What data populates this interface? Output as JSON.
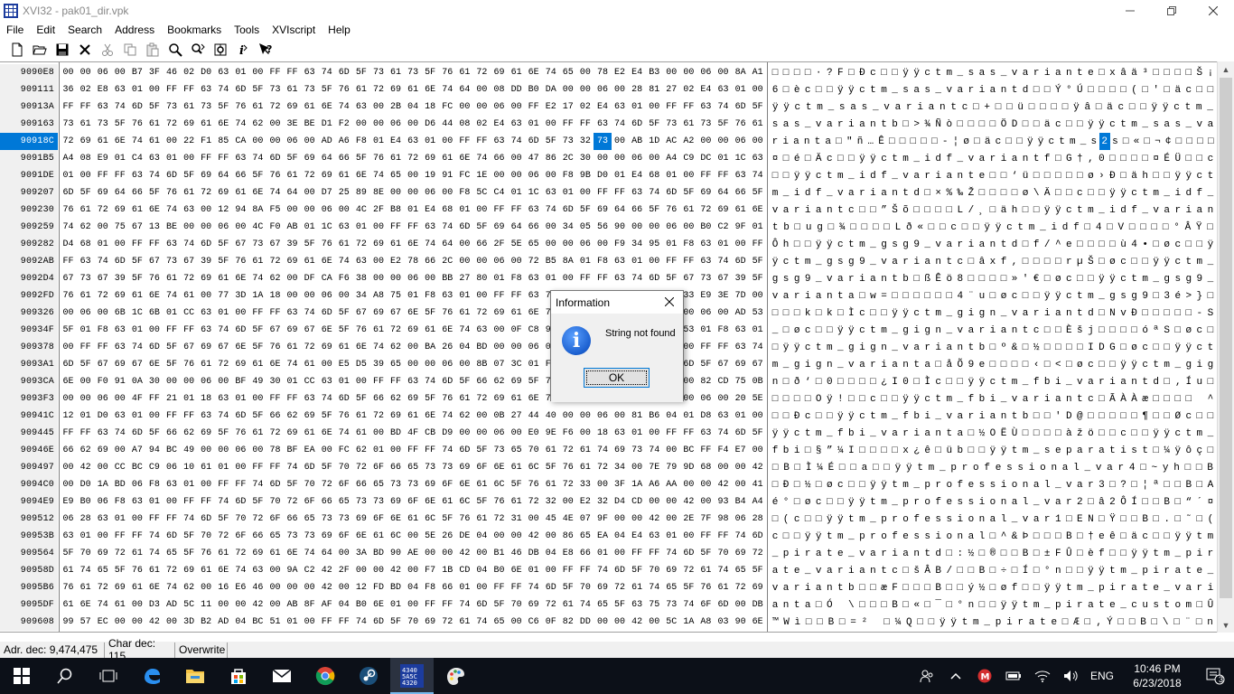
{
  "window": {
    "title": "XVI32 - pak01_dir.vpk",
    "controls": [
      "minimize",
      "maximize",
      "close"
    ]
  },
  "menu": [
    "File",
    "Edit",
    "Search",
    "Address",
    "Bookmarks",
    "Tools",
    "XVIscript",
    "Help"
  ],
  "toolbar": [
    {
      "icon": "new-file-icon"
    },
    {
      "icon": "open-folder-icon"
    },
    {
      "icon": "save-icon"
    },
    {
      "icon": "close-file-icon"
    },
    {
      "icon": "cut-icon"
    },
    {
      "icon": "copy-icon"
    },
    {
      "icon": "paste-icon"
    },
    {
      "icon": "find-icon"
    },
    {
      "icon": "replace-icon"
    },
    {
      "icon": "settings-icon"
    },
    {
      "icon": "script-icon"
    },
    {
      "icon": "help-icon"
    }
  ],
  "editor": {
    "selected_row": 4,
    "selected_col": 31,
    "addresses": [
      "9090E8",
      "909111",
      "90913A",
      "909163",
      "90918C",
      "9091B5",
      "9091DE",
      "909207",
      "909230",
      "909259",
      "909282",
      "9092AB",
      "9092D4",
      "9092FD",
      "909326",
      "90934F",
      "909378",
      "9093A1",
      "9093CA",
      "9093F3",
      "90941C",
      "909445",
      "90946E",
      "909497",
      "9094C0",
      "9094E9",
      "909512",
      "90953B",
      "909564",
      "90958D",
      "9095B6",
      "9095DF",
      "909608"
    ],
    "hex_rows": [
      "00 00 06 00 B7 3F 46 02 D0 63 01 00 FF FF 63 74 6D 5F 73 61 73 5F 76 61 72 69 61 6E 74 65 00 78 E2 E4 B3 00 00 06 00 8A A1",
      "36 02 E8 63 01 00 FF FF 63 74 6D 5F 73 61 73 5F 76 61 72 69 61 6E 74 64 00 08 DD B0 DA 00 00 06 00 28 81 27 02 E4 63 01 00",
      "FF FF 63 74 6D 5F 73 61 73 5F 76 61 72 69 61 6E 74 63 00 2B 04 18 FC 00 00 06 00 FF E2 17 02 E4 63 01 00 FF FF 63 74 6D 5F",
      "73 61 73 5F 76 61 72 69 61 6E 74 62 00 3E BE D1 F2 00 00 06 00 D6 44 08 02 E4 63 01 00 FF FF 63 74 6D 5F 73 61 73 5F 76 61",
      "72 69 61 6E 74 61 00 22 F1 85 CA 00 00 06 00 AD A6 F8 01 E4 63 01 00 FF FF 63 74 6D 5F 73 32 73 00 AB 1D AC A2 00 00 06 00",
      "A4 08 E9 01 C4 63 01 00 FF FF 63 74 6D 5F 69 64 66 5F 76 61 72 69 61 6E 74 66 00 47 86 2C 30 00 00 06 00 A4 C9 DC 01 1C 63",
      "01 00 FF FF 63 74 6D 5F 69 64 66 5F 76 61 72 69 61 6E 74 65 00 19 91 FC 1E 00 00 06 00 F8 9B D0 01 E4 68 01 00 FF FF 63 74",
      "6D 5F 69 64 66 5F 76 61 72 69 61 6E 74 64 00 D7 25 89 8E 00 00 06 00 F8 5C C4 01 1C 63 01 00 FF FF 63 74 6D 5F 69 64 66 5F",
      "76 61 72 69 61 6E 74 63 00 12 94 8A F5 00 00 06 00 4C 2F B8 01 E4 68 01 00 FF FF 63 74 6D 5F 69 64 66 5F 76 61 72 69 61 6E",
      "74 62 00 75 67 13 BE 00 00 06 00 4C F0 AB 01 1C 63 01 00 FF FF 63 74 6D 5F 69 64 66 00 34 05 56 90 00 00 06 00 B0 C2 9F 01",
      "D4 68 01 00 FF FF 63 74 6D 5F 67 73 67 39 5F 76 61 72 69 61 6E 74 64 00 66 2F 5E 65 00 00 06 00 F9 34 95 01 F8 63 01 00 FF",
      "FF 63 74 6D 5F 67 73 67 39 5F 76 61 72 69 61 6E 74 63 00 E2 78 66 2C 00 00 06 00 72 B5 8A 01 F8 63 01 00 FF FF 63 74 6D 5F",
      "67 73 67 39 5F 76 61 72 69 61 6E 74 62 00 DF CA F6 38 00 00 06 00 BB 27 80 01 F8 63 01 00 FF FF 63 74 6D 5F 67 73 67 39 5F",
      "76 61 72 69 61 6E 74 61 00 77 3D 1A 18 00 00 06 00 34 A8 75 01 F8 63 01 00 FF FF 63 74 6D 5F 67 73 67 39 00 33 E9 3E 7D 00",
      "00 06 00 6B 1C 6B 01 CC 63 01 00 FF FF 63 74 6D 5F 67 69 67 6E 5F 76 61 72 69 61 6E 74 64 00 4E 76 AD 05 00 00 06 00 AD 53",
      "5F 01 F8 63 01 00 FF FF 63 74 6D 5F 67 69 67 6E 5F 76 61 72 69 61 6E 74 63 00 0F C8 9A 6A 00 00 06 00 F3 AA 53 01 F8 63 01",
      "00 FF FF 63 74 6D 5F 67 69 67 6E 5F 76 61 72 69 61 6E 74 62 00 BA 26 04 BD 00 00 06 00 49 44 47 01 F8 63 01 00 FF FF 63 74",
      "6D 5F 67 69 67 6E 5F 76 61 72 69 61 6E 74 61 00 E5 D5 39 65 00 00 06 00 8B 07 3C 01 F8 63 01 00 FF FF 63 74 6D 5F 67 69 67",
      "6E 00 F0 91 0A 30 00 00 06 00 BF 49 30 01 CC 63 01 00 FF FF 63 74 6D 5F 66 62 69 5F 76 61 72 69 61 6E 74 64 00 82 CD 75 0B",
      "00 00 06 00 4F FF 21 01 18 63 01 00 FF FF 63 74 6D 5F 66 62 69 5F 76 61 72 69 61 6E 74 63 00 C3 C0 C0 E6 00 00 06 00 20 5E",
      "12 01 D0 63 01 00 FF FF 63 74 6D 5F 66 62 69 5F 76 61 72 69 61 6E 74 62 00 0B 27 44 40 00 00 06 00 81 B6 04 01 D8 63 01 00",
      "FF FF 63 74 6D 5F 66 62 69 5F 76 61 72 69 61 6E 74 61 00 BD 4F CB D9 00 00 06 00 E0 9E F6 00 18 63 01 00 FF FF 63 74 6D 5F",
      "66 62 69 00 A7 94 BC 49 00 00 06 00 78 BF EA 00 FC 62 01 00 FF FF 74 6D 5F 73 65 70 61 72 61 74 69 73 74 00 BC FF F4 E7 00",
      "00 42 00 CC BC C9 06 10 61 01 00 FF FF 74 6D 5F 70 72 6F 66 65 73 73 69 6F 6E 61 6C 5F 76 61 72 34 00 7E 79 9D 68 00 00 42",
      "00 D0 1A BD 06 F8 63 01 00 FF FF 74 6D 5F 70 72 6F 66 65 73 73 69 6F 6E 61 6C 5F 76 61 72 33 00 3F 1A A6 AA 00 00 42 00 41",
      "E9 B0 06 F8 63 01 00 FF FF 74 6D 5F 70 72 6F 66 65 73 73 69 6F 6E 61 6C 5F 76 61 72 32 00 E2 32 D4 CD 00 00 42 00 93 B4 A4",
      "06 28 63 01 00 FF FF 74 6D 5F 70 72 6F 66 65 73 73 69 6F 6E 61 6C 5F 76 61 72 31 00 45 4E 07 9F 00 00 42 00 2E 7F 98 06 28",
      "63 01 00 FF FF 74 6D 5F 70 72 6F 66 65 73 73 69 6F 6E 61 6C 00 5E 26 DE 04 00 00 42 00 86 65 EA 04 E4 63 01 00 FF FF 74 6D",
      "5F 70 69 72 61 74 65 5F 76 61 72 69 61 6E 74 64 00 3A BD 90 AE 00 00 42 00 B1 46 DB 04 E8 66 01 00 FF FF 74 6D 5F 70 69 72",
      "61 74 65 5F 76 61 72 69 61 6E 74 63 00 9A C2 42 2F 00 00 42 00 F7 1B CD 04 B0 6E 01 00 FF FF 74 6D 5F 70 69 72 61 74 65 5F",
      "76 61 72 69 61 6E 74 62 00 16 E6 46 00 00 00 42 00 12 FD BD 04 F8 66 01 00 FF FF 74 6D 5F 70 69 72 61 74 65 5F 76 61 72 69",
      "61 6E 74 61 00 D3 AD 5C 11 00 00 42 00 AB 8F AF 04 B0 6E 01 00 FF FF 74 6D 5F 70 69 72 61 74 65 5F 63 75 73 74 6F 6D 00 DB",
      "99 57 EC 00 00 42 00 3D B2 AD 04 BC 51 01 00 FF FF 74 6D 5F 70 69 72 61 74 65 00 C6 0F 82 DD 00 00 42 00 5C 1A A8 03 90 6E"
    ],
    "text_rows": [
      "□□□□·?F□Ðc□□ÿÿctm_sas_variante□xâä³□□□□Š¡",
      "6□èc□□ÿÿctm_sas_variantd□□Ý°Ú□□□□(□'□äc□□",
      "ÿÿctm_sas_variantc□+□□ü□□□□ÿâ□äc□□ÿÿctm_",
      "sas_variantb□>¾Ñò□□□□ÖD□□äc□□ÿÿctm_sas_va",
      "rianta□\"ñ…Ê□□□□□-¦ø□äc□□ÿÿctm_s2s□«□¬¢□□□□",
      "¤□é□Äc□□ÿÿctm_idf_variantf□G†,0□□□□¤ÉÜ□□c",
      "□□ÿÿctm_idf_variante□□‘ü□□□□□ø›Ð□äh□□ÿÿct",
      "m_idf_variantd□×%‰Ž□□□□ø\\Ä□□c□□ÿÿctm_idf_",
      "variantc□□”Šõ□□□□L/¸□äh□□ÿÿctm_idf_varian",
      "tb□ug□¾□□□□Lð«□□c□□ÿÿctm_idf□4□V□□□□°ÂŸ□",
      "Ôh□□ÿÿctm_gsg9_variantd□f/^e□□□□ù4•□øc□□ÿ",
      "ÿctm_gsg9_variantc□âxf,□□□□rµŠ□øc□□ÿÿctm_",
      "gsg9_variantb□ßÊö8□□□□»'€□øc□□ÿÿctm_gsg9_",
      "varianta□w=□□□□□□4¨u□øc□□ÿÿctm_gsg9□3é>}□",
      "□□□k□k□Ìc□□ÿÿctm_gign_variantd□NvÐ□□□□□-S",
      "_□øc□□ÿÿctm_gign_variantc□□Èšj□□□□óªS□øc□",
      "□ÿÿctm_gign_variantb□º&□½□□□□IDG□øc□□ÿÿct",
      "m_gign_varianta□åÕ9e□□□□‹□<□øc□□ÿÿctm_gig",
      "n□ð‘□0□□□□¿I0□Ìc□□ÿÿctm_fbi_variantd□‚Íu□",
      "□□□□Oÿ!□□c□□ÿÿctm_fbi_variantc□ÃÀÀæ□□□□ ^",
      "□□Ðc□□ÿÿctm_fbi_variantb□□'D@□□□□□¶□□Øc□□",
      "ÿÿctm_fbi_varianta□½OËÙ□□□□àžö□□c□□ÿÿctm_",
      "fbi□§”¼I□□□□x¿ê□üb□□ÿÿtm_separatist□¼ÿôç□",
      "□B□Ì¼É□□a□□ÿÿtm_professional_var4□~yh□□B",
      "□Ð□½□øc□□ÿÿtm_professional_var3□?□¦ª□□B□A",
      "é°□øc□□ÿÿtm_professional_var2□â2ÔÍ□□B□“´¤",
      "□(c□□ÿÿtm_professional_var1□EN□Ÿ□□B□.□˜□(",
      "c□□ÿÿtm_professional□^&Þ□□□B□†eê□äc□□ÿÿtm",
      "_pirate_variantd□:½□®□□B□±FÛ□èf□□ÿÿtm_pir",
      "ate_variantc□šÂB/□□B□÷□Í□°n□□ÿÿtm_pirate_",
      "variantb□□æF□□□B□□ý½□øf□□ÿÿtm_pirate_vari",
      "anta□Ó­\\□□□B□«□¯□°n□□ÿÿtm_pirate_custom□Û",
      "™Wì□□B□=²­□¼Q□□ÿÿtm_pirate□Æ□‚Ý□□B□\\□¨□n"
    ]
  },
  "statusbar": {
    "adr": "Adr. dec: 9,474,475",
    "char": "Char dec: 115",
    "mode": "Overwrite"
  },
  "dialog": {
    "title": "Information",
    "message": "String not found",
    "ok_label": "OK",
    "icon": "information-icon"
  },
  "taskbar": {
    "apps": [
      {
        "icon": "start-icon"
      },
      {
        "icon": "search-icon"
      },
      {
        "icon": "task-view-icon"
      },
      {
        "icon": "edge-icon"
      },
      {
        "icon": "file-explorer-icon"
      },
      {
        "icon": "store-icon"
      },
      {
        "icon": "mail-icon"
      },
      {
        "icon": "chrome-icon"
      },
      {
        "icon": "steam-icon"
      },
      {
        "icon": "xvi32-icon",
        "active": true
      },
      {
        "icon": "paint-icon"
      }
    ],
    "language": "ENG",
    "time": "10:46 PM",
    "date": "6/23/2018",
    "notifications": "3"
  }
}
